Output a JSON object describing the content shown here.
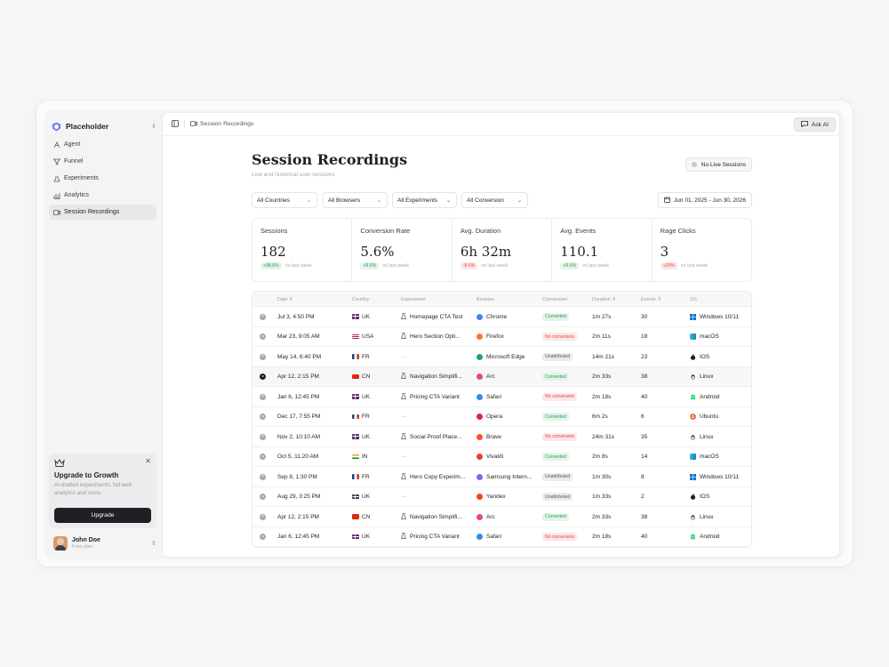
{
  "app": {
    "name": "Placeholder"
  },
  "sidebar": {
    "items": [
      {
        "label": "Agent",
        "icon": "agent-icon"
      },
      {
        "label": "Funnel",
        "icon": "funnel-icon"
      },
      {
        "label": "Experiments",
        "icon": "flask-icon"
      },
      {
        "label": "Analytics",
        "icon": "bar-chart-icon"
      },
      {
        "label": "Session Recordings",
        "icon": "video-icon",
        "active": true
      }
    ],
    "upgrade": {
      "title": "Upgrade to Growth",
      "text": "AI-drafted experiments, full web analytics and more.",
      "button": "Upgrade"
    },
    "user": {
      "name": "John Doe",
      "plan": "Free plan"
    }
  },
  "topbar": {
    "breadcrumb": "Session Recordings",
    "ask_ai": "Ask AI"
  },
  "page": {
    "title": "Session Recordings",
    "subtitle": "Live and historical user sessions",
    "live_button": "No Live Sessions"
  },
  "filters": {
    "countries": "All Countries",
    "browsers": "All Browsers",
    "experiments": "All Experiments",
    "conversion": "All Conversion",
    "date_range": "Jun 01, 2025 - Jun 30, 2026"
  },
  "stats": [
    {
      "label": "Sessions",
      "value": "182",
      "change": "+98.6%",
      "trend": "up",
      "compare": "vs last week"
    },
    {
      "label": "Conversion Rate",
      "value": "5.6%",
      "change": "+8.6%",
      "trend": "up",
      "compare": "vs last week"
    },
    {
      "label": "Avg. Duration",
      "value": "6h 32m",
      "change": "-8.6%",
      "trend": "down",
      "compare": "vs last week"
    },
    {
      "label": "Avg. Events",
      "value": "110.1",
      "change": "+8.6%",
      "trend": "up",
      "compare": "vs last week"
    },
    {
      "label": "Rage Clicks",
      "value": "3",
      "change": "+20%",
      "trend": "down",
      "compare": "vs last week"
    }
  ],
  "table": {
    "columns": [
      "Date ⇕",
      "Country",
      "Experiment",
      "Browser",
      "Conversion",
      "Duration ⇕",
      "Events ⇕",
      "OS"
    ],
    "rows": [
      {
        "date": "Jul 3, 4:50 PM",
        "country": "UK",
        "flag": "uk",
        "experiment": "Homepage CTA Test",
        "browser": "Chrome",
        "bcolor": "#4285f4",
        "conversion": "Converted",
        "ctype": "conv",
        "duration": "1m 27s",
        "events": "30",
        "os": "Windows 10/11",
        "ocolor": "#0078d4"
      },
      {
        "date": "Mar 23, 9:05 AM",
        "country": "USA",
        "flag": "usa",
        "experiment": "Hero Section Opti...",
        "browser": "Firefox",
        "bcolor": "#ff7139",
        "conversion": "No conversion",
        "ctype": "noconv",
        "duration": "2m 11s",
        "events": "18",
        "os": "macOS",
        "ocolor": "#2bb0e6"
      },
      {
        "date": "May 14, 6:40 PM",
        "country": "FR",
        "flag": "fr",
        "experiment": "",
        "browser": "Microsoft Edge",
        "bcolor": "#1fa37a",
        "conversion": "Unattributed",
        "ctype": "unatt",
        "duration": "14m 21s",
        "events": "23",
        "os": "IOS",
        "ocolor": "#1f2024"
      },
      {
        "date": "Apr 12, 2:15 PM",
        "country": "CN",
        "flag": "cn",
        "experiment": "Navigation Simplifi...",
        "browser": "Arc",
        "bcolor": "#e0468e",
        "conversion": "Converted",
        "ctype": "conv",
        "duration": "2m 33s",
        "events": "38",
        "os": "Linux",
        "ocolor": "#f0b400",
        "active": true
      },
      {
        "date": "Jan 6, 12:45 PM",
        "country": "UK",
        "flag": "uk",
        "experiment": "Pricing CTA Variant",
        "browser": "Safari",
        "bcolor": "#2d8cf0",
        "conversion": "No conversion",
        "ctype": "noconv",
        "duration": "2m 18s",
        "events": "40",
        "os": "Android",
        "ocolor": "#3ddc84"
      },
      {
        "date": "Dec 17, 7:55 PM",
        "country": "FR",
        "flag": "fr",
        "experiment": "",
        "browser": "Opera",
        "bcolor": "#e0253a",
        "conversion": "Converted",
        "ctype": "conv",
        "duration": "6m 2s",
        "events": "6",
        "os": "Ubuntu",
        "ocolor": "#e95420"
      },
      {
        "date": "Nov 2, 10:10 AM",
        "country": "UK",
        "flag": "uk",
        "experiment": "Social Proof Place...",
        "browser": "Brave",
        "bcolor": "#fb542b",
        "conversion": "No conversion",
        "ctype": "noconv",
        "duration": "24m 31s",
        "events": "35",
        "os": "Linux",
        "ocolor": "#f0b400"
      },
      {
        "date": "Oct 5, 11:20 AM",
        "country": "IN",
        "flag": "in",
        "experiment": "",
        "browser": "Vivaldi",
        "bcolor": "#ef3939",
        "conversion": "Converted",
        "ctype": "conv",
        "duration": "2m 8s",
        "events": "14",
        "os": "macOS",
        "ocolor": "#2bb0e6"
      },
      {
        "date": "Sep 8, 1:30 PM",
        "country": "FR",
        "flag": "fr",
        "experiment": "Hero Copy Experim...",
        "browser": "Samsung Intern...",
        "bcolor": "#7a6cf0",
        "conversion": "Unattributed",
        "ctype": "unatt",
        "duration": "1m 30s",
        "events": "8",
        "os": "Windows 10/11",
        "ocolor": "#0078d4"
      },
      {
        "date": "Aug 29, 3:25 PM",
        "country": "UK",
        "flag": "uk",
        "experiment": "",
        "browser": "Yandex",
        "bcolor": "#fc3f1d",
        "conversion": "Unattributed",
        "ctype": "unatt",
        "duration": "1m 33s",
        "events": "2",
        "os": "IOS",
        "ocolor": "#1f2024"
      },
      {
        "date": "Apr 12, 2:15 PM",
        "country": "CN",
        "flag": "cn",
        "experiment": "Navigation Simplifi...",
        "browser": "Arc",
        "bcolor": "#e0468e",
        "conversion": "Converted",
        "ctype": "conv",
        "duration": "2m 33s",
        "events": "38",
        "os": "Linux",
        "ocolor": "#f0b400"
      },
      {
        "date": "Jan 6, 12:45 PM",
        "country": "UK",
        "flag": "uk",
        "experiment": "Pricing CTA Variant",
        "browser": "Safari",
        "bcolor": "#2d8cf0",
        "conversion": "No conversion",
        "ctype": "noconv",
        "duration": "2m 18s",
        "events": "40",
        "os": "Android",
        "ocolor": "#3ddc84"
      }
    ]
  }
}
